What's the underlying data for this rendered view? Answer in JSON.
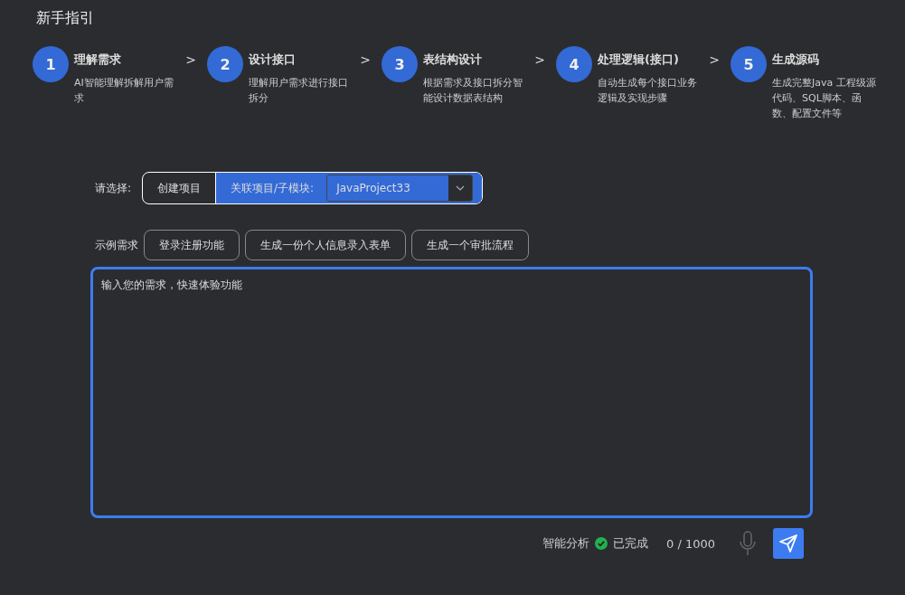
{
  "title": "新手指引",
  "steps": [
    {
      "number": "1",
      "title": "理解需求",
      "description": "AI智能理解拆解用户需求",
      "separator": ">"
    },
    {
      "number": "2",
      "title": "设计接口",
      "description": "理解用户需求进行接口拆分",
      "separator": ">"
    },
    {
      "number": "3",
      "title": "表结构设计",
      "description": "根据需求及接口拆分智能设计数据表结构",
      "separator": ">"
    },
    {
      "number": "4",
      "title": "处理逻辑(接口)",
      "description": "自动生成每个接口业务逻辑及实现步骤",
      "separator": ">"
    },
    {
      "number": "5",
      "title": "生成源码",
      "description": "生成完整Java 工程级源代码、SQL脚本、函数、配置文件等"
    }
  ],
  "project_select": {
    "label": "请选择:",
    "options": [
      {
        "label": "创建项目",
        "selected": false
      },
      {
        "label": "关联项目/子模块:",
        "selected": true
      }
    ],
    "dropdown_value": "JavaProject33"
  },
  "examples": {
    "label": "示例需求",
    "items": [
      "登录注册功能",
      "生成一份个人信息录入表单",
      "生成一个审批流程"
    ]
  },
  "input": {
    "placeholder": "输入您的需求，快速体验功能"
  },
  "footer": {
    "analysis_label": "智能分析",
    "status": "已完成",
    "done": true,
    "counter": "0 / 1000"
  }
}
